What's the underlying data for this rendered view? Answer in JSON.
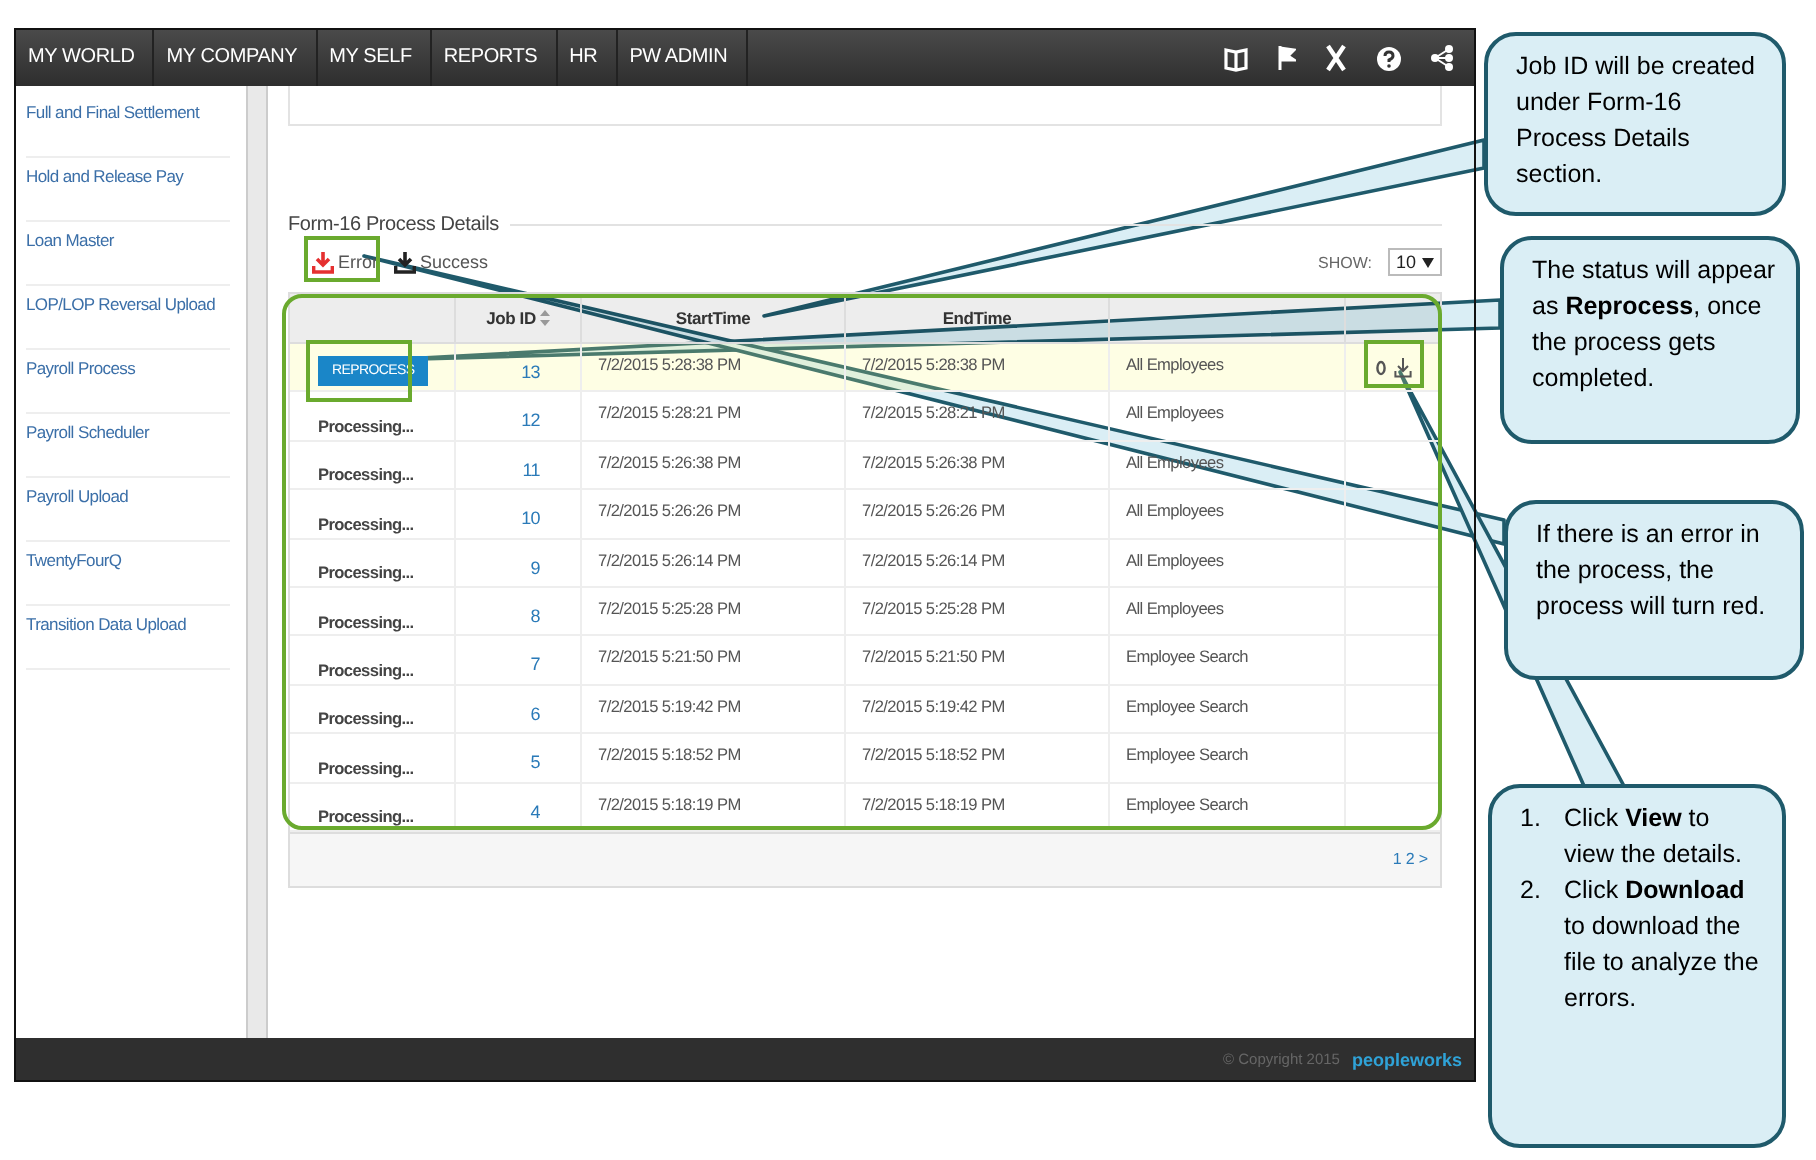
{
  "nav": {
    "items": [
      {
        "label": "MY WORLD"
      },
      {
        "label": "MY COMPANY"
      },
      {
        "label": "MY SELF"
      },
      {
        "label": "REPORTS"
      },
      {
        "label": "HR"
      },
      {
        "label": "PW ADMIN"
      }
    ]
  },
  "sidebar": {
    "items": [
      "Full and Final Settlement",
      "Hold and Release Pay",
      "Loan Master",
      "LOP/LOP Reversal Upload",
      "Payroll Process",
      "Payroll Scheduler",
      "Payroll Upload",
      "TwentyFourQ",
      "Transition Data Upload"
    ]
  },
  "section": {
    "title": "Form-16 Process Details",
    "exports": [
      {
        "label": "Error",
        "kind": "error"
      },
      {
        "label": "Success",
        "kind": "success"
      }
    ],
    "show": {
      "label": "SHOW:",
      "value": "10"
    }
  },
  "table": {
    "columns": [
      {
        "label": "Job ID"
      },
      {
        "label": "StartTime"
      },
      {
        "label": "EndTime"
      }
    ],
    "rows": [
      {
        "status": {
          "kind": "button",
          "label": "REPROCESS"
        },
        "job_id": "13",
        "start": "7/2/2015 5:28:38 PM",
        "end": "7/2/2015 5:28:38 PM",
        "column_5": "All Employees",
        "highlighted": true,
        "actions": true
      },
      {
        "status": {
          "kind": "text",
          "label": "Processing..."
        },
        "job_id": "12",
        "start": "7/2/2015 5:28:21 PM",
        "end": "7/2/2015 5:28:21 PM",
        "column_5": "All Employees",
        "highlighted": false,
        "actions": false
      },
      {
        "status": {
          "kind": "text",
          "label": "Processing..."
        },
        "job_id": "11",
        "start": "7/2/2015 5:26:38 PM",
        "end": "7/2/2015 5:26:38 PM",
        "column_5": "All Employees",
        "highlighted": false,
        "actions": false
      },
      {
        "status": {
          "kind": "text",
          "label": "Processing..."
        },
        "job_id": "10",
        "start": "7/2/2015 5:26:26 PM",
        "end": "7/2/2015 5:26:26 PM",
        "column_5": "All Employees",
        "highlighted": false,
        "actions": false
      },
      {
        "status": {
          "kind": "text",
          "label": "Processing..."
        },
        "job_id": "9",
        "start": "7/2/2015 5:26:14 PM",
        "end": "7/2/2015 5:26:14 PM",
        "column_5": "All Employees",
        "highlighted": false,
        "actions": false
      },
      {
        "status": {
          "kind": "text",
          "label": "Processing..."
        },
        "job_id": "8",
        "start": "7/2/2015 5:25:28 PM",
        "end": "7/2/2015 5:25:28 PM",
        "column_5": "All Employees",
        "highlighted": false,
        "actions": false
      },
      {
        "status": {
          "kind": "text",
          "label": "Processing..."
        },
        "job_id": "7",
        "start": "7/2/2015 5:21:50 PM",
        "end": "7/2/2015 5:21:50 PM",
        "column_5": "Employee Search",
        "highlighted": false,
        "actions": false
      },
      {
        "status": {
          "kind": "text",
          "label": "Processing..."
        },
        "job_id": "6",
        "start": "7/2/2015 5:19:42 PM",
        "end": "7/2/2015 5:19:42 PM",
        "column_5": "Employee Search",
        "highlighted": false,
        "actions": false
      },
      {
        "status": {
          "kind": "text",
          "label": "Processing..."
        },
        "job_id": "5",
        "start": "7/2/2015 5:18:52 PM",
        "end": "7/2/2015 5:18:52 PM",
        "column_5": "Employee Search",
        "highlighted": false,
        "actions": false
      },
      {
        "status": {
          "kind": "text",
          "label": "Processing..."
        },
        "job_id": "4",
        "start": "7/2/2015 5:18:19 PM",
        "end": "7/2/2015 5:18:19 PM",
        "column_5": "Employee Search",
        "highlighted": false,
        "actions": false
      }
    ],
    "pagination": [
      "1",
      "2",
      ">"
    ]
  },
  "footer": {
    "copyright": "© Copyright 2015",
    "brand": "peopleworks"
  },
  "callouts": [
    {
      "kind": "text",
      "text": "Job ID will be created under Form-16 Process Details section."
    },
    {
      "kind": "text",
      "text": "The status will appear as **Reprocess**, once the process gets completed."
    },
    {
      "kind": "text",
      "text": "If there is an error in the process, the process will turn red."
    },
    {
      "kind": "list",
      "items": [
        {
          "number": "1.",
          "text": "Click **View** to view the details."
        },
        {
          "number": "2.",
          "text": "Click **Download** to download the file to analyze the errors."
        }
      ]
    }
  ]
}
